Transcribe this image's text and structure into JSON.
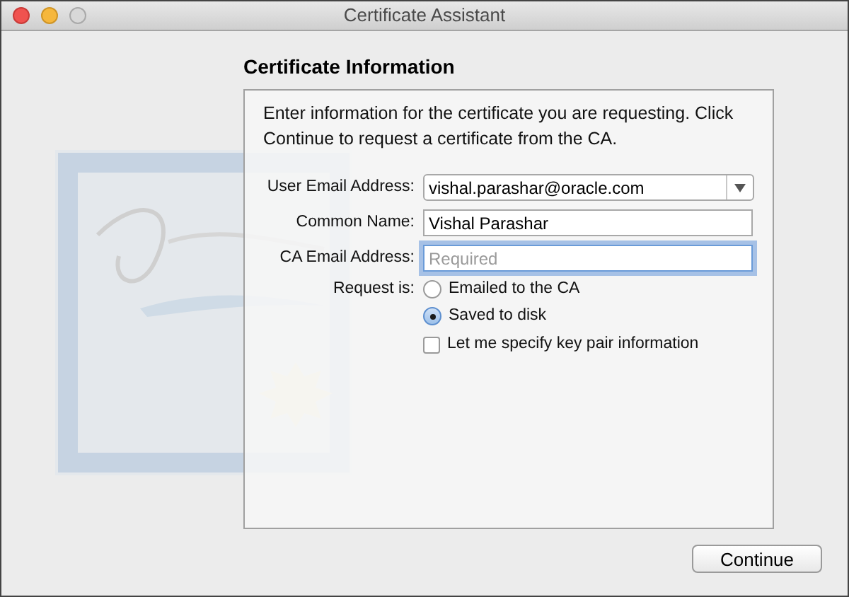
{
  "window": {
    "title": "Certificate Assistant"
  },
  "heading": "Certificate Information",
  "intro": "Enter information for the certificate you are requesting. Click Continue to request a certificate from the CA.",
  "fields": [
    {
      "kind": "popup",
      "label": "User Email Address:",
      "value": "vishal.parashar@oracle.com"
    },
    {
      "kind": "text",
      "label": "Common Name:",
      "value": "Vishal Parashar",
      "focused": false
    },
    {
      "kind": "text",
      "label": "CA Email Address:",
      "placeholder": "Required",
      "focused": true
    }
  ],
  "request": {
    "label": "Request is:",
    "options": [
      {
        "label": "Emailed to the CA",
        "selected": false
      },
      {
        "label": "Saved to disk",
        "selected": true
      }
    ]
  },
  "key_pair": {
    "label": "Let me specify key pair information",
    "checked": false
  },
  "buttons": [
    "Continue"
  ]
}
